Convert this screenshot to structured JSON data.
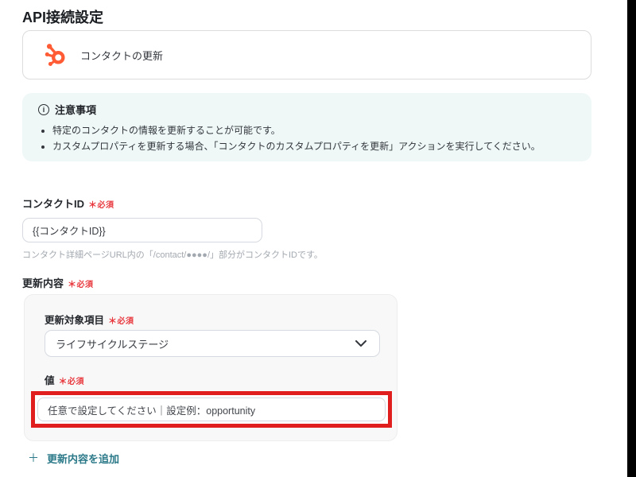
{
  "page": {
    "title": "API接続設定"
  },
  "action_card": {
    "label": "コンタクトの更新",
    "icon": "hubspot-sprocket",
    "icon_color": "#ff5c35"
  },
  "notice": {
    "title": "注意事項",
    "items": [
      "特定のコンタクトの情報を更新することが可能です。",
      "カスタムプロパティを更新する場合、「コンタクトのカスタムプロパティを更新」アクションを実行してください。"
    ],
    "bg_color": "#eff8f7"
  },
  "required": {
    "asterisk": "＊",
    "label": "必須",
    "color": "#e8383d"
  },
  "contact_id_field": {
    "label": "コンタクトID",
    "value": "{{コンタクトID}}",
    "helper": "コンタクト詳細ページURL内の「/contact/●●●●/」部分がコンタクトIDです。"
  },
  "update_section": {
    "label": "更新内容",
    "target_field": {
      "label": "更新対象項目",
      "selected": "ライフサイクルステージ"
    },
    "value_field": {
      "label": "値",
      "value": "任意で設定してください｜設定例：opportunity",
      "highlight_color": "#e01e1e"
    },
    "add_link": {
      "plus": "＋",
      "label": "更新内容を追加",
      "color": "#2c7a89"
    }
  }
}
